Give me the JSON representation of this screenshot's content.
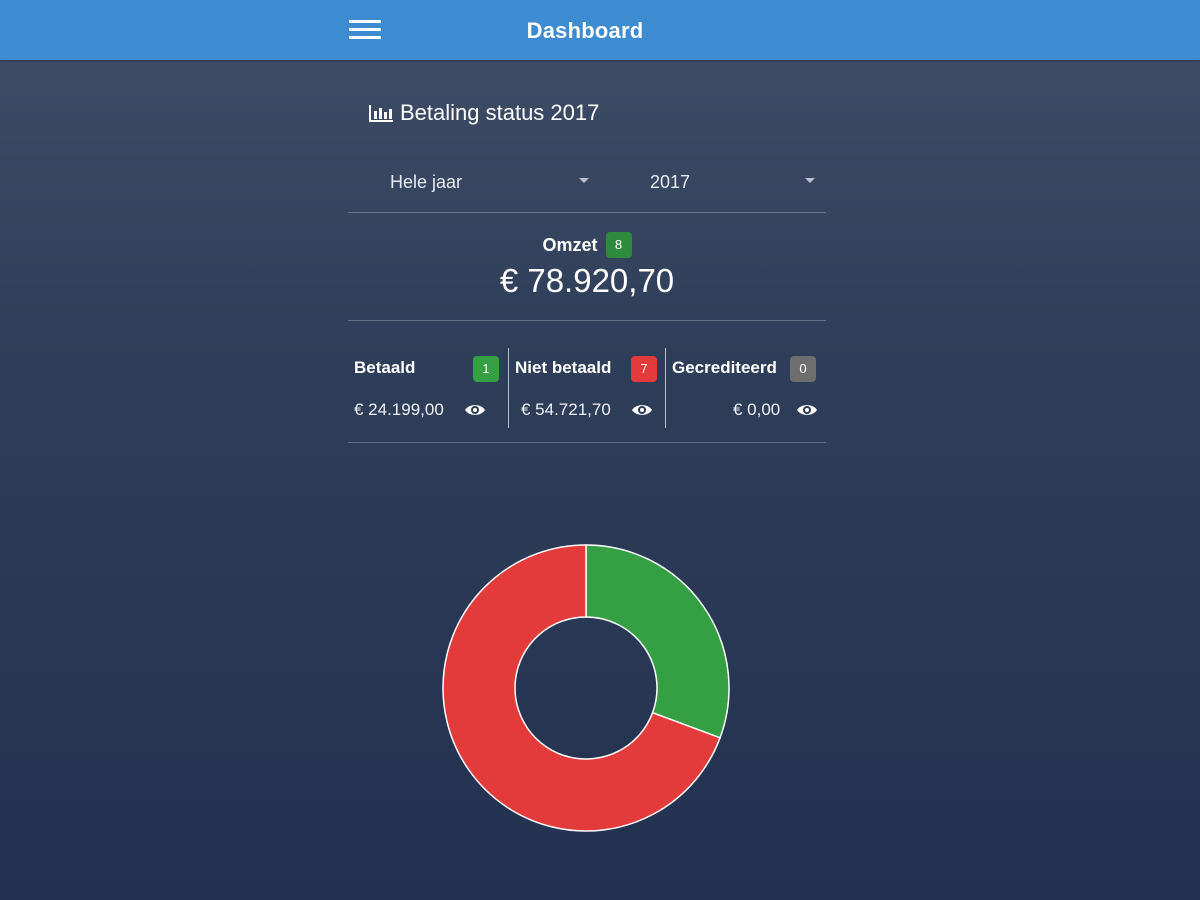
{
  "appbar": {
    "title": "Dashboard",
    "menu_icon": "hamburger-menu-icon"
  },
  "section": {
    "title": "Betaling status 2017",
    "icon": "bar-chart-icon"
  },
  "filters": {
    "period": "Hele jaar",
    "year": "2017"
  },
  "omzet": {
    "label": "Omzet",
    "count": "8",
    "amount": "€ 78.920,70"
  },
  "status": {
    "betaald": {
      "label": "Betaald",
      "count": "1",
      "amount": "€ 24.199,00",
      "color": "#35a043"
    },
    "niet_betaald": {
      "label": "Niet betaald",
      "count": "7",
      "amount": "€ 54.721,70",
      "color": "#e33b3b"
    },
    "gecrediteerd": {
      "label": "Gecrediteerd",
      "count": "0",
      "amount": "€ 0,00",
      "color": "#6e6e6e"
    }
  },
  "chart_data": {
    "type": "pie",
    "series": [
      {
        "name": "Betaald",
        "value": 24199.0,
        "color": "#35a043"
      },
      {
        "name": "Niet betaald",
        "value": 54721.7,
        "color": "#e33b3b"
      },
      {
        "name": "Gecrediteerd",
        "value": 0,
        "color": "#6e6e6e"
      }
    ],
    "donut": true
  },
  "colors": {
    "appbar": "#3d8bd0",
    "background_top": "#404e68",
    "background_bottom": "#223150"
  }
}
